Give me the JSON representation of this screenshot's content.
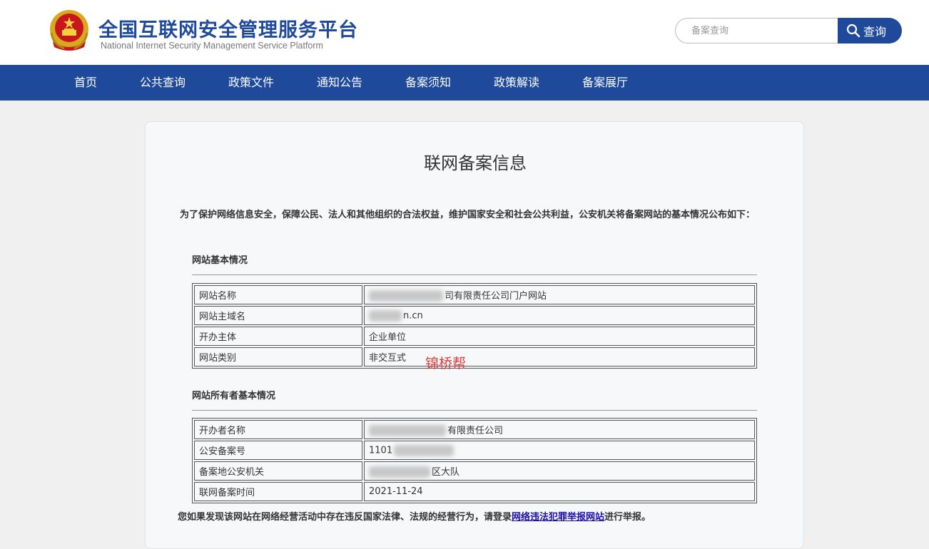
{
  "header": {
    "title_cn": "全国互联网安全管理服务平台",
    "title_en": "National Internet Security Management Service Platform",
    "search_placeholder": "备案查询",
    "search_button": "查询",
    "emblem_icon": "national-emblem-icon"
  },
  "nav": {
    "items": [
      "首页",
      "公共查询",
      "政策文件",
      "通知公告",
      "备案须知",
      "政策解读",
      "备案展厅"
    ]
  },
  "main": {
    "title": "联网备案信息",
    "intro": "为了保护网络信息安全，保障公民、法人和其他组织的合法权益，维护国家安全和社会公共利益，公安机关将备案网站的基本情况公布如下：",
    "site_section": {
      "title": "网站基本情况",
      "rows": [
        {
          "label": "网站名称",
          "value": "司有限责任公司门户网站"
        },
        {
          "label": "网站主域名",
          "value": "n.cn"
        },
        {
          "label": "开办主体",
          "value": "企业单位"
        },
        {
          "label": "网站类别",
          "value": "非交互式"
        }
      ]
    },
    "owner_section": {
      "title": "网站所有者基本情况",
      "rows": [
        {
          "label": "开办者名称",
          "value": "有限责任公司"
        },
        {
          "label": "公安备案号",
          "value": "1101"
        },
        {
          "label": "备案地公安机关",
          "value": "区大队"
        },
        {
          "label": "联网备案时间",
          "value": "2021-11-24"
        }
      ]
    },
    "watermark": "锦桥帮",
    "report_prefix": "您如果发现该网站在网络经营活动中存在违反国家法律、法规的经营行为，请登录",
    "report_link": "网络违法犯罪举报网站",
    "report_suffix": "进行举报。"
  },
  "colors": {
    "brand_blue": "#1f4a9c",
    "watermark_red": "#e03c3c",
    "link": "#1a0dab"
  }
}
